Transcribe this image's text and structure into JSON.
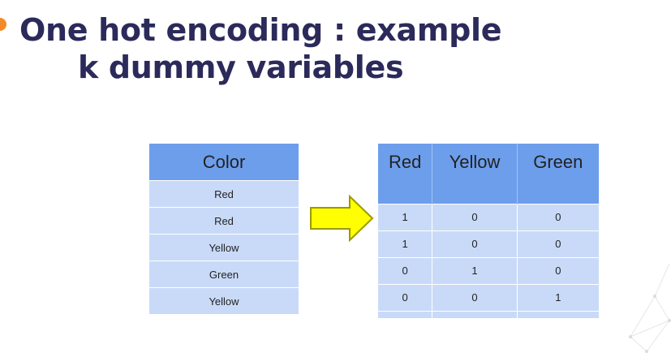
{
  "title": {
    "line1": "One hot encoding : example",
    "line2": "k dummy variables"
  },
  "input_table": {
    "header": "Color",
    "rows": [
      "Red",
      "Red",
      "Yellow",
      "Green",
      "Yellow"
    ]
  },
  "output_table": {
    "headers": [
      "Red",
      "Yellow",
      "Green"
    ],
    "rows": [
      [
        "1",
        "0",
        "0"
      ],
      [
        "1",
        "0",
        "0"
      ],
      [
        "0",
        "1",
        "0"
      ],
      [
        "0",
        "0",
        "1"
      ]
    ]
  },
  "colors": {
    "title": "#2b2a5a",
    "bullet": "#f28c28",
    "header_fill": "#6d9eeb",
    "cell_fill": "#c9daf8",
    "arrow_fill": "#ffff00",
    "arrow_stroke": "#9a9a00"
  },
  "icons": {
    "arrow": "right-arrow-icon",
    "bullet": "bullet-dot-icon"
  }
}
